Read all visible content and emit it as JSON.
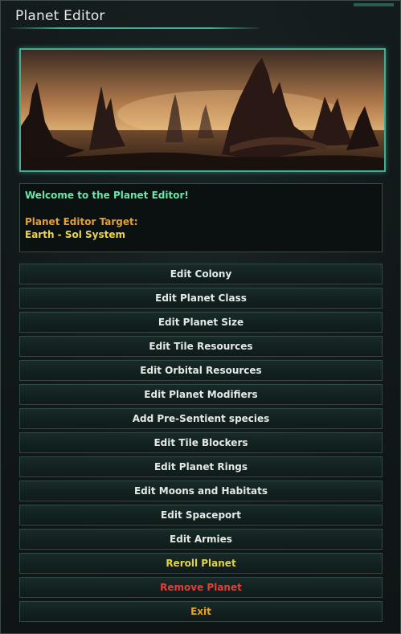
{
  "window": {
    "title": "Planet Editor"
  },
  "info": {
    "welcome": "Welcome to the Planet Editor!",
    "target_label": "Planet Editor Target:",
    "target_value": "Earth - Sol System"
  },
  "menu": {
    "items": [
      {
        "label": "Edit Colony"
      },
      {
        "label": "Edit Planet Class"
      },
      {
        "label": "Edit Planet Size"
      },
      {
        "label": "Edit Tile Resources"
      },
      {
        "label": "Edit Orbital Resources"
      },
      {
        "label": "Edit Planet Modifiers"
      },
      {
        "label": "Add Pre-Sentient species"
      },
      {
        "label": "Edit Tile Blockers"
      },
      {
        "label": "Edit Planet Rings"
      },
      {
        "label": "Edit Moons and Habitats"
      },
      {
        "label": "Edit Spaceport"
      },
      {
        "label": "Edit Armies"
      },
      {
        "label": "Reroll Planet"
      },
      {
        "label": "Remove Planet"
      },
      {
        "label": "Exit"
      }
    ]
  },
  "colors": {
    "accent": "#3fae94",
    "welcome": "#6ee5a8",
    "target_label": "#e6a02f",
    "target_value": "#e8d54c",
    "reroll": "#e2d246",
    "remove": "#e0403a",
    "exit": "#e5a22d"
  }
}
